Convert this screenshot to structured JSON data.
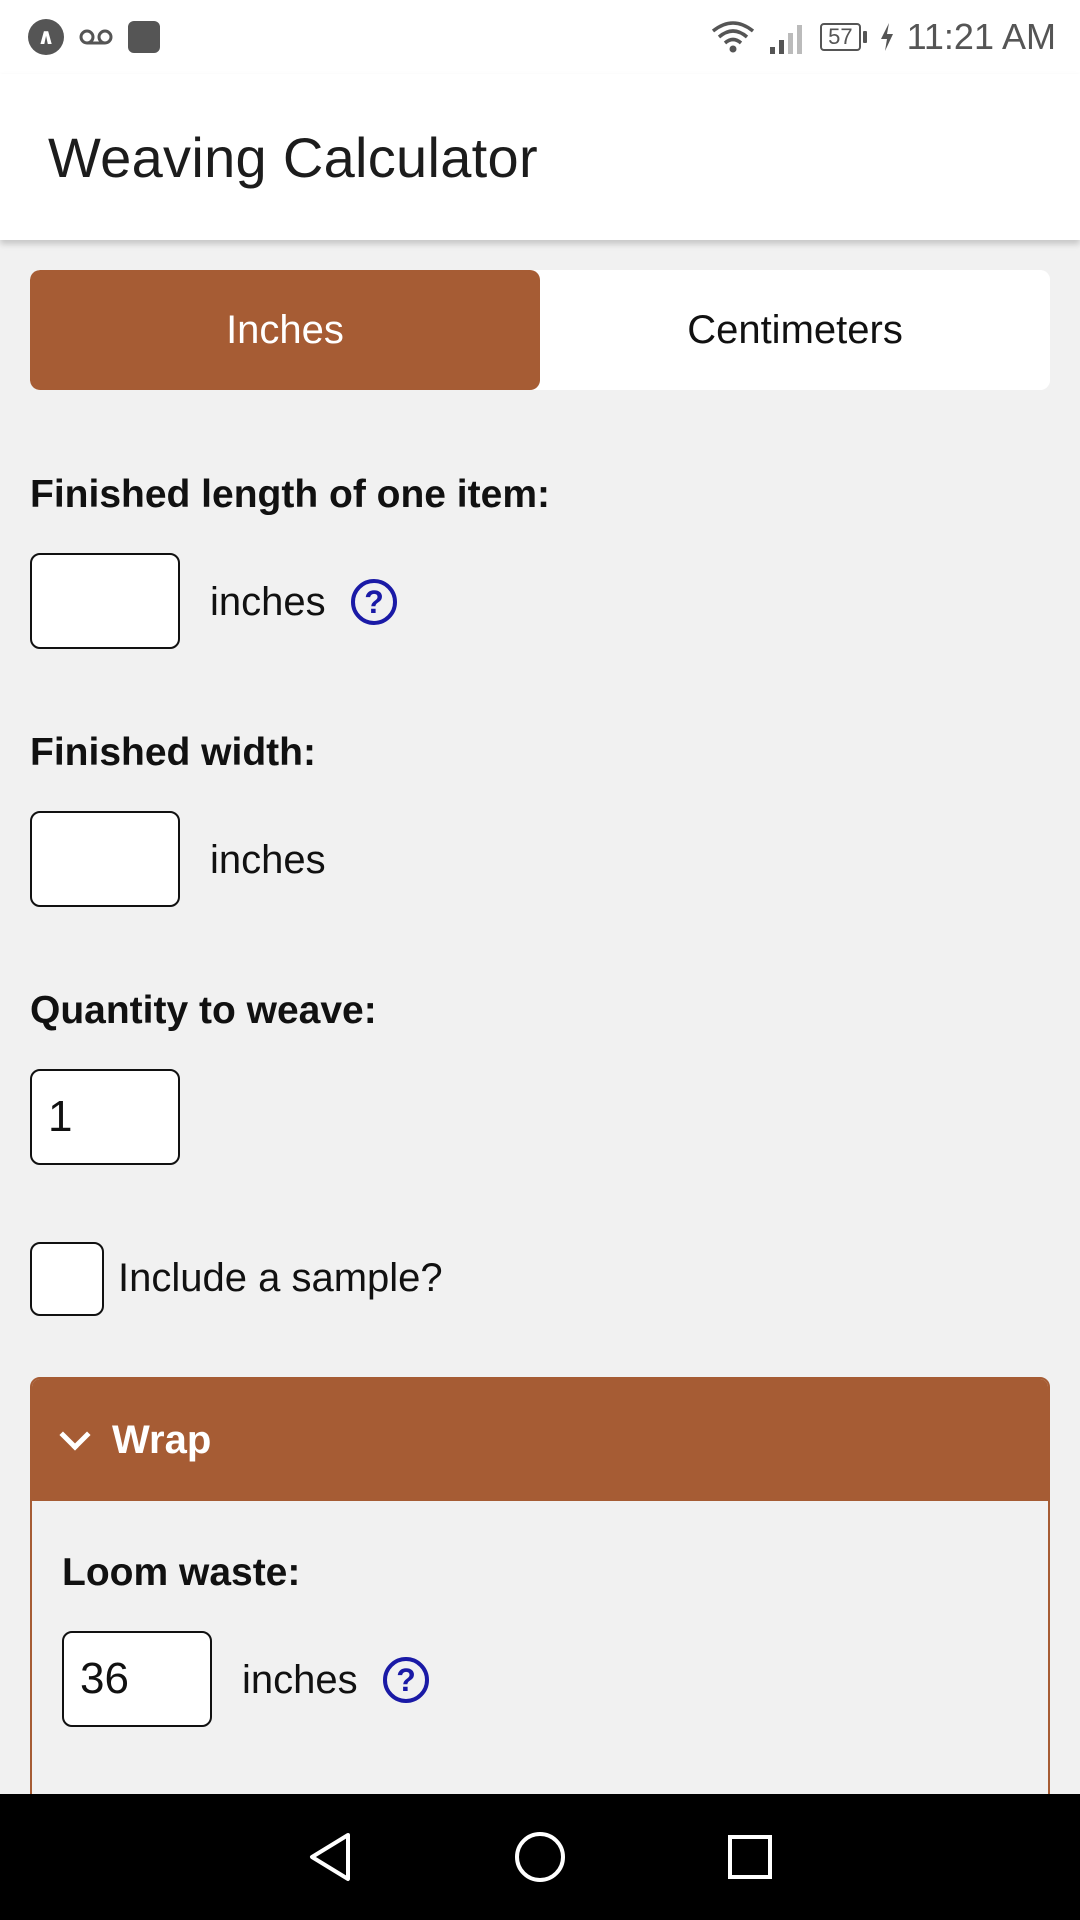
{
  "status_bar": {
    "battery": "57",
    "time": "11:21 AM",
    "icons": [
      "app-badge-icon",
      "voicemail-icon",
      "stop-icon",
      "wifi-icon",
      "signal-icon",
      "battery-icon",
      "charging-icon"
    ]
  },
  "app": {
    "title": "Weaving Calculator"
  },
  "units": {
    "inches_label": "Inches",
    "centimeters_label": "Centimeters",
    "selected": "Inches"
  },
  "finished_length": {
    "label": "Finished length of one item:",
    "value": "",
    "unit": "inches"
  },
  "finished_width": {
    "label": "Finished width:",
    "value": "",
    "unit": "inches"
  },
  "quantity": {
    "label": "Quantity to weave:",
    "value": "1"
  },
  "sample": {
    "label": "Include a sample?",
    "checked": false
  },
  "wrap_section": {
    "title": "Wrap",
    "loom_waste": {
      "label": "Loom waste:",
      "value": "36",
      "unit": "inches"
    }
  },
  "help_glyph": "?",
  "colors": {
    "accent": "#a65c34",
    "help_icon": "#1a1aa6",
    "background": "#f1f1f1"
  }
}
